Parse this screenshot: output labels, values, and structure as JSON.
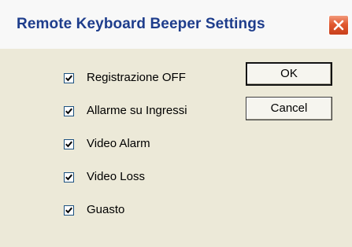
{
  "window": {
    "title": "Remote Keyboard Beeper Settings",
    "close_icon": "close-icon"
  },
  "options": [
    {
      "label": "Registrazione OFF",
      "checked": true
    },
    {
      "label": "Allarme su Ingressi",
      "checked": true
    },
    {
      "label": "Video Alarm",
      "checked": true
    },
    {
      "label": "Video Loss",
      "checked": true
    },
    {
      "label": "Guasto",
      "checked": true
    }
  ],
  "buttons": {
    "ok_label": "OK",
    "cancel_label": "Cancel"
  },
  "colors": {
    "title_text": "#1e3d8c",
    "dialog_background": "#ece9d8",
    "close_button": "#e1582f",
    "checkbox_border": "#1c5180"
  }
}
